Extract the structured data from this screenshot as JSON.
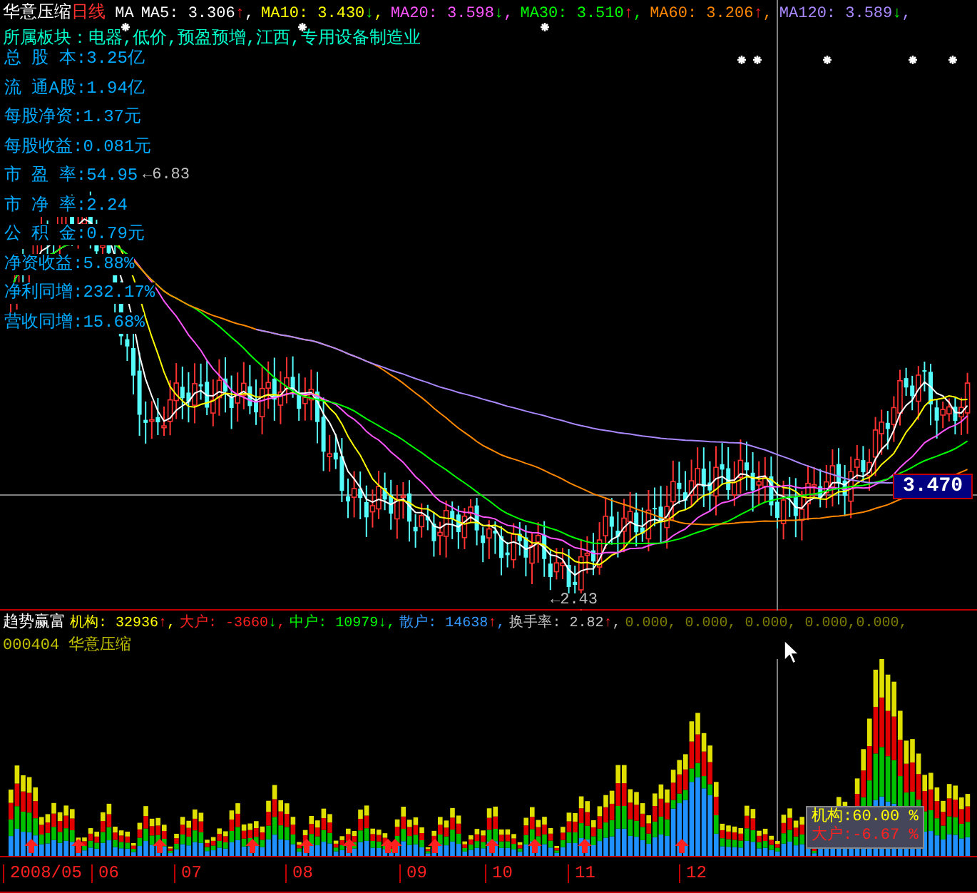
{
  "header": {
    "stock_name": "华意压缩",
    "period": "日线",
    "ma_label": "MA",
    "ma_items": [
      {
        "label": "MA5:",
        "value": "3.306",
        "arrow": "↑",
        "rising": true,
        "separator": ",",
        "color": "#ffffff"
      },
      {
        "label": "MA10:",
        "value": "3.430",
        "arrow": "↓",
        "rising": false,
        "separator": ",",
        "color": "#ffff00"
      },
      {
        "label": "MA20:",
        "value": "3.598",
        "arrow": "↓",
        "rising": false,
        "separator": ",",
        "color": "#ff55ff"
      },
      {
        "label": "MA30:",
        "value": "3.510",
        "arrow": "↑",
        "rising": true,
        "separator": ",",
        "color": "#00ff00"
      },
      {
        "label": "MA60:",
        "value": "3.206",
        "arrow": "↑",
        "rising": true,
        "separator": ",",
        "color": "#ff8800"
      },
      {
        "label": "MA120:",
        "value": "3.589",
        "arrow": "↓",
        "rising": false,
        "separator": ",",
        "color": "#aa88ff"
      }
    ]
  },
  "sector": "所属板块：电器,低价,预盈预增,江西,专用设备制造业",
  "fundamentals": [
    "总 股 本:3.25亿",
    "流 通A股:1.94亿",
    "每股净资:1.37元",
    "每股收益:0.081元",
    "市 盈 率:54.95",
    "市 净 率:2.24",
    "公 积 金:0.79元",
    "净资收益:5.88%",
    "净利同增:232.17%",
    "营收同增:15.68%"
  ],
  "high_marker": "←6.83",
  "low_marker": "←2.43",
  "price_label": "3.470",
  "indicator": {
    "name": "趋势赢富",
    "items": [
      {
        "label": "机构:",
        "value": "32936",
        "arrow": "↑",
        "rising": true,
        "separator": ",",
        "color": "#ffff00"
      },
      {
        "label": "大户:",
        "value": "-3660",
        "arrow": "↓",
        "rising": false,
        "separator": ",",
        "color": "#ff2020"
      },
      {
        "label": "中户:",
        "value": "10979",
        "arrow": "↓",
        "rising": false,
        "separator": ",",
        "color": "#00ff00"
      },
      {
        "label": "散户:",
        "value": "14638",
        "arrow": "↑",
        "rising": true,
        "separator": ",",
        "color": "#3399ff"
      },
      {
        "label": "换手率:",
        "value": "2.82",
        "arrow": "↑",
        "rising": true,
        "separator": ",",
        "color": "#c0c0c0"
      }
    ],
    "extra": "0.000, 0.000, 0.000, 0.000,0.000,",
    "stock_line": "000404 华意压缩"
  },
  "tooltip": [
    {
      "label": "机构:",
      "value": "60.00 %",
      "color": "#ffff00"
    },
    {
      "label": "大户:",
      "value": "-6.67 %",
      "color": "#ff2020"
    }
  ],
  "axis_labels": [
    "2008/05",
    "06",
    "07",
    "08",
    "09",
    "10",
    "11",
    "12"
  ]
}
